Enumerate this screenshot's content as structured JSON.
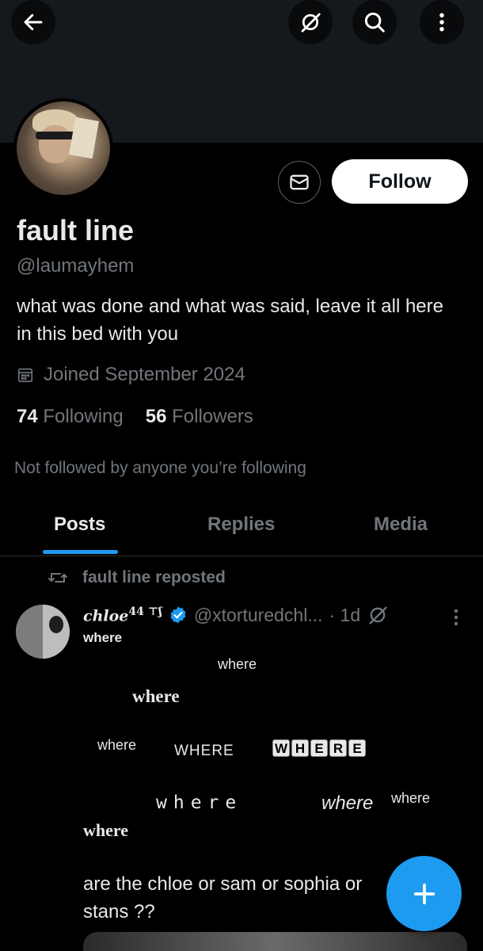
{
  "header": {
    "back_icon": "back-arrow-icon",
    "grok_icon": "grok-icon",
    "search_icon": "search-icon",
    "more_icon": "more-vertical-icon"
  },
  "profile": {
    "display_name": "fault line",
    "handle": "@laumayhem",
    "bio": "what was done and what was said, leave it all here in this bed with you",
    "joined": "Joined September 2024",
    "following_count": "74",
    "following_label": "Following",
    "followers_count": "56",
    "followers_label": "Followers",
    "not_followed": "Not followed by anyone you’re following",
    "follow_label": "Follow"
  },
  "tabs": [
    {
      "label": "Posts",
      "active": true
    },
    {
      "label": "Replies",
      "active": false
    },
    {
      "label": "Media",
      "active": false
    }
  ],
  "post": {
    "repost_label": "fault line reposted",
    "author_name": "chloe",
    "author_suffix": "44 ⊤ʃ",
    "author_handle": "@xtorturedchl...",
    "time": "· 1d",
    "words": {
      "w1": "where",
      "w2": "where",
      "w3": "where",
      "w4": "where",
      "w5": "WHERE",
      "w6": [
        "W",
        "H",
        "E",
        "R",
        "E"
      ],
      "w7": "where",
      "w8": "where",
      "w9": "where",
      "w10": "where"
    },
    "text": "are the chloe or sam or sophia or\nstans ??"
  },
  "colors": {
    "accent": "#1d9bf0",
    "background": "#000000",
    "secondary_text": "#71767b",
    "primary_text": "#e7e9ea"
  }
}
